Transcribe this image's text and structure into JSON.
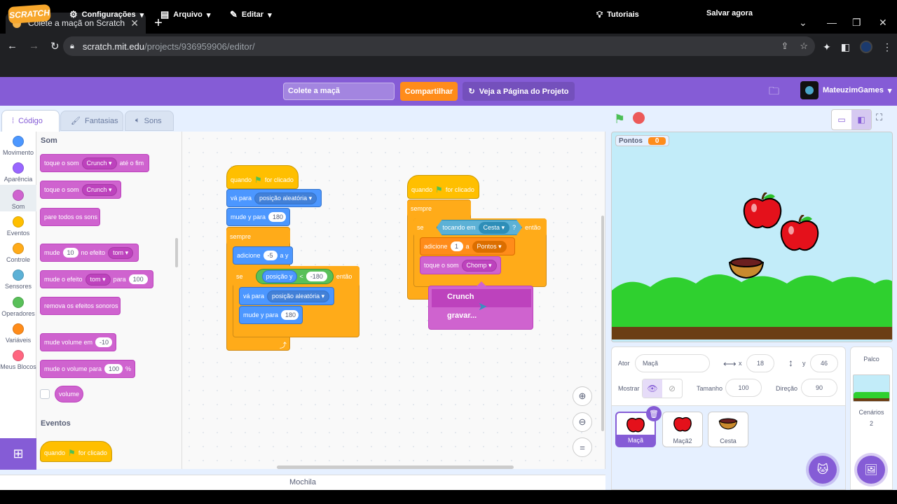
{
  "browser": {
    "tab_title": "Colete a maçã on Scratch",
    "url_host": "scratch.mit.edu",
    "url_path": "/projects/936959906/editor/"
  },
  "menu": {
    "settings": "Configurações",
    "file": "Arquivo",
    "edit": "Editar",
    "project_title": "Colete a maçã",
    "share": "Compartilhar",
    "see_project": "Veja a Página do Projeto",
    "tutorials": "Tutoriais",
    "save_now": "Salvar agora",
    "username": "MateuzimGames",
    "logo": "SCRATCH"
  },
  "tabs": {
    "code": "Código",
    "costumes": "Fantasias",
    "sounds": "Sons"
  },
  "categories": [
    {
      "label": "Movimento",
      "color": "#4c97ff"
    },
    {
      "label": "Aparência",
      "color": "#9966ff"
    },
    {
      "label": "Som",
      "color": "#cf63cf"
    },
    {
      "label": "Eventos",
      "color": "#ffbf00"
    },
    {
      "label": "Controle",
      "color": "#ffab19"
    },
    {
      "label": "Sensores",
      "color": "#5cb1d6"
    },
    {
      "label": "Operadores",
      "color": "#59c059"
    },
    {
      "label": "Variáveis",
      "color": "#ff8c1a"
    },
    {
      "label": "Meus Blocos",
      "color": "#ff6680"
    }
  ],
  "palette": {
    "sound_header": "Som",
    "play_until_done": {
      "pre": "toque o som",
      "sound": "Crunch",
      "post": "até o fim"
    },
    "start_sound": {
      "pre": "toque o som",
      "sound": "Crunch"
    },
    "stop_all": "pare todos os sons",
    "change_effect": {
      "pre": "mude",
      "value": "10",
      "mid": "no efeito",
      "effect": "tom"
    },
    "set_effect": {
      "pre": "mude o efeito",
      "effect": "tom",
      "mid": "para",
      "value": "100"
    },
    "clear_effects": "remova os efeitos sonoros",
    "change_volume": {
      "pre": "mude volume em",
      "value": "-10"
    },
    "set_volume": {
      "pre": "mude o volume para",
      "value": "100",
      "post": "%"
    },
    "volume_reporter": "volume",
    "events_header": "Eventos",
    "when_flag": {
      "pre": "quando",
      "post": "for clicado"
    }
  },
  "script1": {
    "hat_pre": "quando",
    "hat_post": "for clicado",
    "goto_pre": "vá para",
    "goto_target": "posição aleatória",
    "point_pre": "mude y para",
    "point_val": "180",
    "forever": "sempre",
    "changey_pre": "adicione",
    "changey_val": "-5",
    "changey_post": "a y",
    "if_pre": "se",
    "if_then": "então",
    "cond_left": "posição y",
    "cond_op": "<",
    "cond_right": "-180",
    "goto2_pre": "vá para",
    "goto2_target": "posição aleatória",
    "sety2_pre": "mude y para",
    "sety2_val": "180"
  },
  "script2": {
    "hat_pre": "quando",
    "hat_post": "for clicado",
    "forever": "sempre",
    "if_pre": "se",
    "if_then": "então",
    "touch_pre": "tocando em",
    "touch_target": "Cesta",
    "touch_q": "?",
    "add_pre": "adicione",
    "add_val": "1",
    "add_mid": "a",
    "add_var": "Pontos",
    "play_pre": "toque o som",
    "play_sound": "Chomp"
  },
  "dropdown": {
    "selected": "Crunch",
    "other": "gravar..."
  },
  "backpack": "Mochila",
  "stage": {
    "monitor_label": "Pontos",
    "monitor_value": "0"
  },
  "sprite_info": {
    "sprite_label": "Ator",
    "sprite_name": "Maçã",
    "x_label": "x",
    "x": "18",
    "y_label": "y",
    "y": "46",
    "show_label": "Mostrar",
    "size_label": "Tamanho",
    "size": "100",
    "direction_label": "Direção",
    "direction": "90"
  },
  "sprites": [
    {
      "name": "Maçã",
      "icon": "apple-icon"
    },
    {
      "name": "Maçã2",
      "icon": "apple-icon"
    },
    {
      "name": "Cesta",
      "icon": "basket-icon"
    }
  ],
  "stage_pane": {
    "title": "Palco",
    "backdrops_label": "Cenários",
    "backdrops_count": "2"
  }
}
